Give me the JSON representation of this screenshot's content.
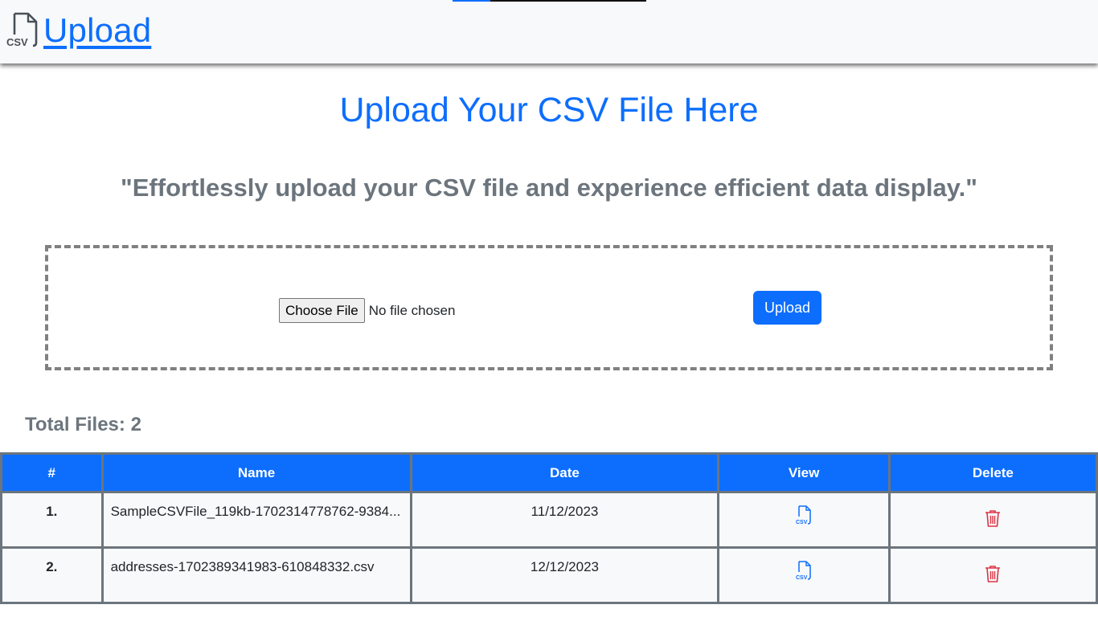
{
  "navbar": {
    "brand_text": "Upload",
    "brand_icon": "csv-file-icon",
    "brand_icon_label": "CSV"
  },
  "hero": {
    "title": "Upload Your CSV File Here",
    "subtitle": "\"Effortlessly upload your CSV file and experience efficient data display.\""
  },
  "upload": {
    "choose_label": "Choose File",
    "file_status": "No file chosen",
    "button_label": "Upload"
  },
  "files": {
    "total_label": "Total Files: 2",
    "columns": [
      "#",
      "Name",
      "Date",
      "View",
      "Delete"
    ],
    "rows": [
      {
        "index": "1.",
        "name": "SampleCSVFile_119kb-1702314778762-9384...",
        "date": "11/12/2023",
        "view_icon": "csv-file-icon",
        "delete_icon": "trash-icon"
      },
      {
        "index": "2.",
        "name": "addresses-1702389341983-610848332.csv",
        "date": "12/12/2023",
        "view_icon": "csv-file-icon",
        "delete_icon": "trash-icon"
      }
    ]
  },
  "colors": {
    "primary": "#0d6efd",
    "muted": "#6c757d",
    "danger": "#dc3545",
    "navbar_bg": "#f8f9fa"
  }
}
